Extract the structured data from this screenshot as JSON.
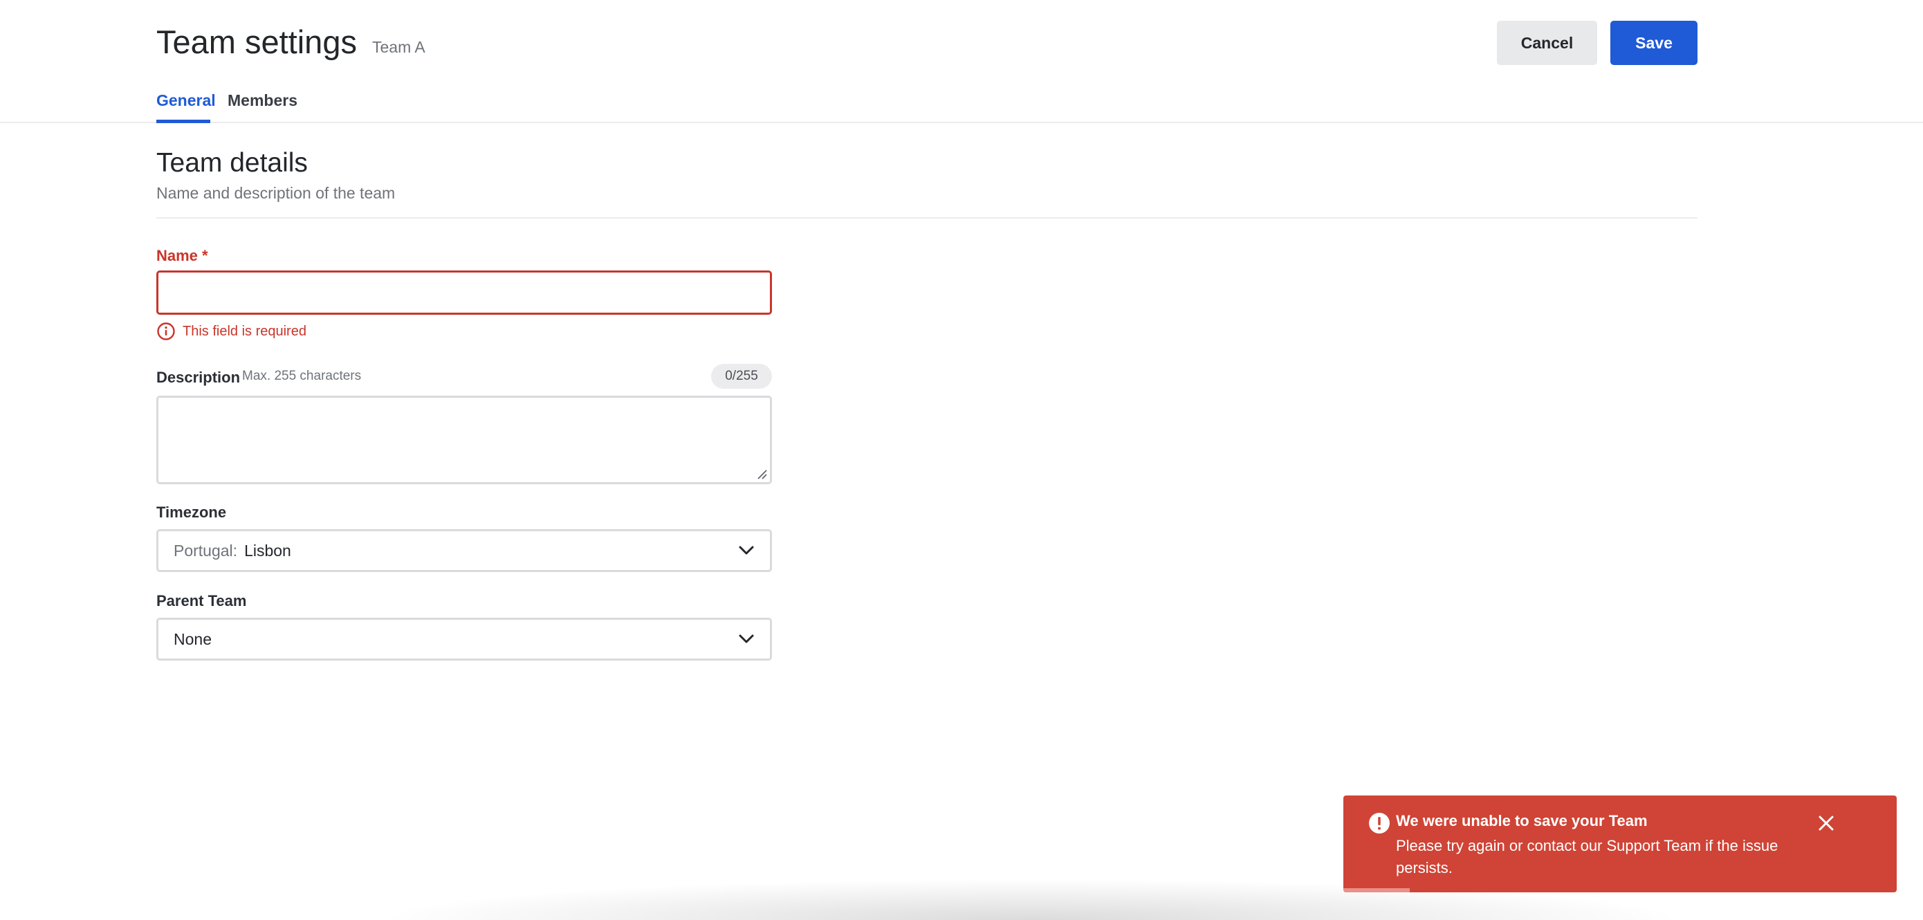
{
  "header": {
    "title": "Team settings",
    "subtitle": "Team A",
    "cancel_label": "Cancel",
    "save_label": "Save"
  },
  "tabs": [
    {
      "label": "General",
      "active": true
    },
    {
      "label": "Members",
      "active": false
    }
  ],
  "section": {
    "title": "Team details",
    "subtitle": "Name and description of the team"
  },
  "form": {
    "name": {
      "label": "Name *",
      "value": "",
      "error": "This field is required"
    },
    "description": {
      "label": "Description",
      "hint": "Max. 255 characters",
      "counter": "0/255",
      "value": ""
    },
    "timezone": {
      "label": "Timezone",
      "prefix": "Portugal:",
      "value": "Lisbon"
    },
    "parent_team": {
      "label": "Parent Team",
      "value": "None"
    }
  },
  "toast": {
    "title": "We were unable to save your Team",
    "message": "Please try again or contact our Support Team if the issue persists.",
    "progress": 0.12
  },
  "colors": {
    "accent": "#1f5ad7",
    "error": "#c9352a",
    "toast_bg": "#cf4436"
  },
  "icons": {
    "error_field": "info-circle-icon",
    "toast": "exclamation-circle-icon",
    "close": "close-icon",
    "select": "chevron-down-icon"
  }
}
